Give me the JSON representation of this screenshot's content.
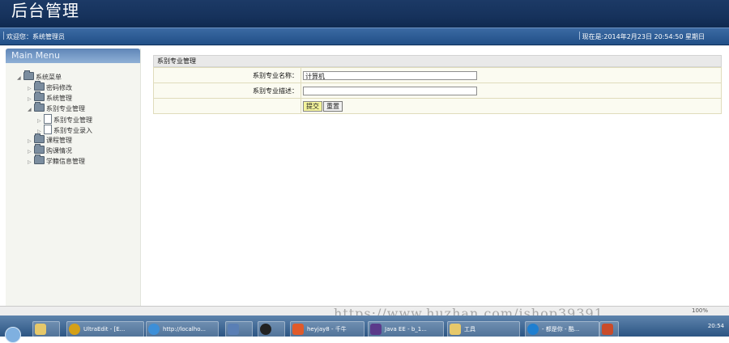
{
  "header": {
    "title": "后台管理"
  },
  "welcome_bar": {
    "left": "欢迎您：系统管理员",
    "right": "现在是:2014年2月23日  20:54:50 星期日"
  },
  "sidebar": {
    "menu_title": "Main Menu",
    "root": "系统菜单",
    "items": [
      {
        "label": "密码修改"
      },
      {
        "label": "系统管理"
      },
      {
        "label": "系别专业管理",
        "children": [
          "系别专业管理",
          "系别专业录入"
        ]
      },
      {
        "label": "课程管理"
      },
      {
        "label": "购课情况"
      },
      {
        "label": "学籍信息管理"
      }
    ]
  },
  "form": {
    "heading": "系别专业管理",
    "name_label": "系别专业名称：",
    "name_value": "计算机",
    "desc_label": "系别专业描述：",
    "desc_value": "",
    "submit_label": "提交",
    "reset_label": "重置"
  },
  "status": {
    "zoom": "100%"
  },
  "taskbar": {
    "tasks": [
      "UltraEdit - [E...",
      "http://localho...",
      "",
      "",
      "heyjay8 - 千牛",
      "Java EE - b_1...",
      "工具",
      "- 都是你 - 酷..."
    ],
    "clock": "20:54"
  },
  "watermark": "https://www.huzhan.com/ishop39391",
  "colors": {
    "header": "#16325c",
    "welcome_bar": "#2e5d96",
    "panel_bg": "#fbfbf1",
    "submit_btn": "#f3f39c"
  }
}
